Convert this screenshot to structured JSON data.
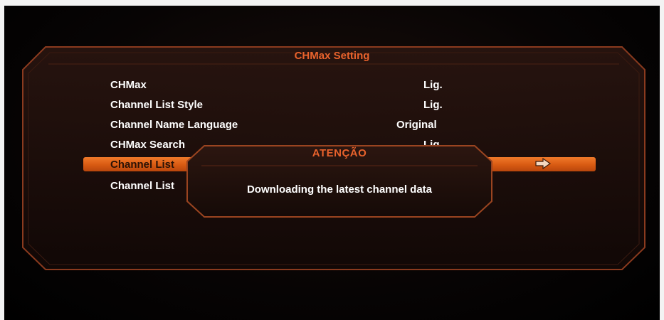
{
  "menu": {
    "title": "CHMax Setting",
    "items": [
      {
        "label": "CHMax",
        "value": "Lig."
      },
      {
        "label": "Channel List Style",
        "value": "Lig."
      },
      {
        "label": "Channel Name Language",
        "value": "Original"
      },
      {
        "label": "CHMax Search",
        "value": "Lig."
      },
      {
        "label": "Channel List",
        "value": ""
      },
      {
        "label": "Channel List",
        "value": ""
      }
    ],
    "selected_index": 4
  },
  "dialog": {
    "title": "ATENÇÃO",
    "message": "Downloading the latest channel data"
  },
  "icons": {
    "selected_row_icon": "hand-pointer-right-icon"
  },
  "colors": {
    "accent": "#e8622c",
    "highlight": "#d85a12",
    "text": "#ffffff",
    "background": "#000000"
  }
}
